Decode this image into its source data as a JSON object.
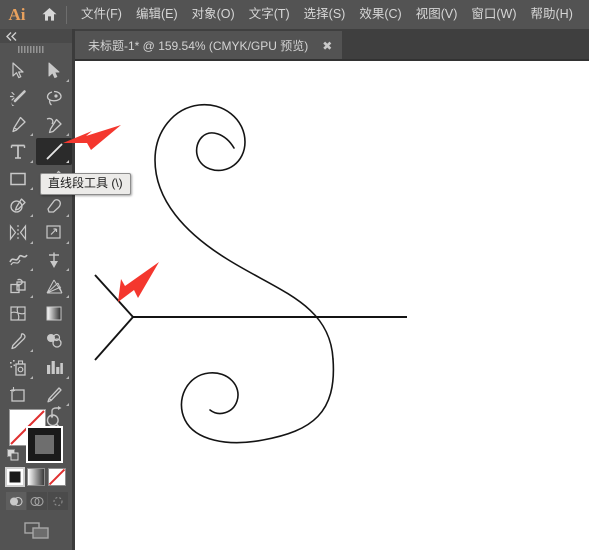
{
  "app": {
    "name": "Adobe Illustrator",
    "logo_text": "Ai",
    "logo_color": "#e8a15e",
    "background_color": "#535353",
    "canvas_color": "#ffffff",
    "annotation_color": "#f4372e"
  },
  "menubar": {
    "home_icon": "home-icon",
    "items": [
      {
        "label": "文件(F)",
        "name": "menu-file"
      },
      {
        "label": "编辑(E)",
        "name": "menu-edit"
      },
      {
        "label": "对象(O)",
        "name": "menu-object"
      },
      {
        "label": "文字(T)",
        "name": "menu-type"
      },
      {
        "label": "选择(S)",
        "name": "menu-select"
      },
      {
        "label": "效果(C)",
        "name": "menu-effect"
      },
      {
        "label": "视图(V)",
        "name": "menu-view"
      },
      {
        "label": "窗口(W)",
        "name": "menu-window"
      },
      {
        "label": "帮助(H)",
        "name": "menu-help"
      }
    ]
  },
  "tabbar": {
    "tab_title": "未标题-1* @ 159.54% (CMYK/GPU 预览)",
    "close_label": "✖",
    "document_name": "未标题-1*",
    "zoom_level": "159.54%",
    "color_mode": "CMYK/GPU 预览"
  },
  "toolbar": {
    "collapse_icon": "double-chevron-left-icon",
    "grip_icon": "drag-grip-icon",
    "active_tool": "line-segment-tool",
    "tools": [
      {
        "name": "selection-tool",
        "icon": "arrow-cursor-icon",
        "has_flyout": false
      },
      {
        "name": "direct-selection-tool",
        "icon": "white-arrow-cursor-icon",
        "has_flyout": true
      },
      {
        "name": "magic-wand-tool",
        "icon": "magic-wand-icon",
        "has_flyout": false
      },
      {
        "name": "lasso-tool",
        "icon": "lasso-icon",
        "has_flyout": false
      },
      {
        "name": "pen-tool",
        "icon": "pen-nib-icon",
        "has_flyout": true
      },
      {
        "name": "curvature-tool",
        "icon": "curvature-pen-icon",
        "has_flyout": true
      },
      {
        "name": "type-tool",
        "icon": "type-T-icon",
        "has_flyout": true
      },
      {
        "name": "line-segment-tool",
        "icon": "diagonal-line-icon",
        "has_flyout": true
      },
      {
        "name": "rectangle-tool",
        "icon": "rectangle-icon",
        "has_flyout": true
      },
      {
        "name": "paintbrush-tool",
        "icon": "paintbrush-icon",
        "has_flyout": true
      },
      {
        "name": "shaper-tool",
        "icon": "shaper-pencil-icon",
        "has_flyout": true
      },
      {
        "name": "eraser-tool",
        "icon": "eraser-icon",
        "has_flyout": true
      },
      {
        "name": "rotate-tool",
        "icon": "reflect-axis-icon",
        "has_flyout": true
      },
      {
        "name": "scale-tool",
        "icon": "scale-corner-icon",
        "has_flyout": true
      },
      {
        "name": "width-tool",
        "icon": "width-warp-icon",
        "has_flyout": true
      },
      {
        "name": "free-transform-tool",
        "icon": "pushpin-icon",
        "has_flyout": true
      },
      {
        "name": "shape-builder-tool",
        "icon": "shape-builder-icon",
        "has_flyout": true
      },
      {
        "name": "perspective-grid-tool",
        "icon": "perspective-grid-icon",
        "has_flyout": true
      },
      {
        "name": "mesh-tool",
        "icon": "mesh-icon",
        "has_flyout": false
      },
      {
        "name": "gradient-tool",
        "icon": "gradient-square-icon",
        "has_flyout": false
      },
      {
        "name": "eyedropper-tool",
        "icon": "eyedropper-icon",
        "has_flyout": true
      },
      {
        "name": "blend-tool",
        "icon": "blend-circles-icon",
        "has_flyout": false
      },
      {
        "name": "symbol-sprayer-tool",
        "icon": "symbol-sprayer-icon",
        "has_flyout": true
      },
      {
        "name": "column-graph-tool",
        "icon": "bar-graph-icon",
        "has_flyout": true
      },
      {
        "name": "artboard-tool",
        "icon": "artboard-icon",
        "has_flyout": false
      },
      {
        "name": "slice-tool",
        "icon": "slice-knife-icon",
        "has_flyout": true
      },
      {
        "name": "hand-tool",
        "icon": "hand-icon",
        "has_flyout": true
      },
      {
        "name": "zoom-tool",
        "icon": "magnifier-icon",
        "has_flyout": false
      }
    ],
    "color_controls": {
      "fill_swatch": {
        "name": "fill-color-swatch",
        "value": "none-white",
        "color": "#ffffff"
      },
      "stroke_swatch": {
        "name": "stroke-color-swatch",
        "value": "black",
        "color": "#1a1a1a"
      },
      "swap_icon": "swap-fill-stroke-icon",
      "default_icon": "default-fill-stroke-icon",
      "modes": [
        {
          "name": "color-mode-button",
          "icon": "solid-color-icon",
          "selected": true
        },
        {
          "name": "gradient-mode-button",
          "icon": "gradient-icon",
          "selected": false
        },
        {
          "name": "none-mode-button",
          "icon": "none-slash-icon",
          "selected": false
        }
      ],
      "draw_modes": [
        {
          "name": "draw-normal-button",
          "icon": "draw-normal-icon",
          "selected": true
        },
        {
          "name": "draw-behind-button",
          "icon": "draw-behind-icon",
          "selected": false
        },
        {
          "name": "draw-inside-button",
          "icon": "draw-inside-icon",
          "selected": false
        }
      ],
      "screen_mode": {
        "name": "change-screen-mode-button",
        "icon": "screen-mode-icon"
      }
    }
  },
  "tooltip": {
    "text": "直线段工具 (\\)",
    "tool": "line-segment-tool"
  },
  "canvas": {
    "artwork_name": "ornamental-swirl-and-arrow-drawing",
    "stroke_color": "#141414",
    "stroke_width": 1.6,
    "shapes": [
      {
        "name": "upper-spiral-path",
        "type": "spiral-curve"
      },
      {
        "name": "lower-spiral-path",
        "type": "spiral-curve"
      },
      {
        "name": "horizontal-line-segment",
        "type": "line"
      },
      {
        "name": "chevron-upper-line-segment",
        "type": "line"
      },
      {
        "name": "chevron-lower-line-segment",
        "type": "line"
      }
    ]
  },
  "annotations": [
    {
      "name": "arrow-pointing-to-line-tool",
      "target": "line-segment-tool",
      "direction": "left",
      "color": "#f4372e"
    },
    {
      "name": "arrow-pointing-to-chevron-vertex",
      "target": "chevron-vertex",
      "direction": "down-left",
      "color": "#f4372e"
    }
  ]
}
